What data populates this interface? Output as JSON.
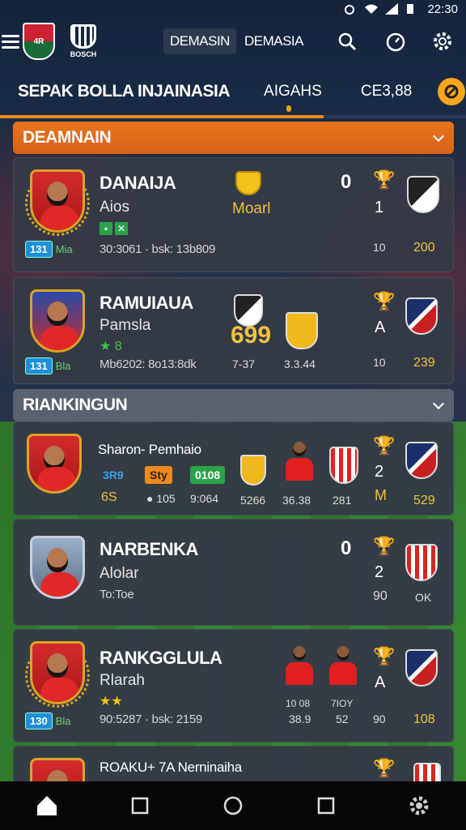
{
  "status": {
    "time": "22:30"
  },
  "header": {
    "tab_active": "DEMASIN",
    "tab_other": "DEMASIA",
    "logo2_text": "BOSCH"
  },
  "nav": {
    "title": "SEPAK BOLLA INJAINASIA",
    "item1": "AIGAHS",
    "item2": "CE3,88"
  },
  "sections": [
    {
      "label": "DEAMNAIN"
    },
    {
      "label": "RIANKINGUN"
    }
  ],
  "cards": [
    {
      "name": "DANAIJA",
      "sub": "Aios",
      "meta": "30:3061 · bsk: 13b809",
      "badge_num": "131",
      "badge_label": "Mia",
      "center_text": "Moarl",
      "score_top": "0",
      "score_mid": "1",
      "score_small": "10",
      "score_gold": "200"
    },
    {
      "name": "RAMUIAUA",
      "sub": "Pamsla",
      "meta": "Mb6202: 8o13:8dk",
      "badge_num": "131",
      "badge_label": "Bla",
      "stars": "★ 8",
      "big_num": "699",
      "left_small": "7-37",
      "mid_small": "3.3.44",
      "score_mid": "A",
      "score_small": "10",
      "score_gold": "239"
    },
    {
      "name": "Sharon- Pemhaio",
      "chip1": "3R9",
      "chip2": "Sty",
      "chip3": "0108",
      "line_gold": "6S",
      "line2a": "105",
      "line2b": "9:064",
      "c1": "5266",
      "c2": "36.38",
      "c3": "281",
      "score_mid": "2",
      "score_letter": "M",
      "score_gold": "529"
    },
    {
      "name": "NARBENKA",
      "sub": "Alolar",
      "meta": "To:Toe",
      "score_top": "0",
      "score_mid": "2",
      "score_small": "90",
      "score_right": "OK"
    },
    {
      "name": "RANKGGLULA",
      "sub": "Rlarah",
      "stars": "★★",
      "meta": "90:5287 · bsk: 2159",
      "badge_num": "130",
      "badge_label": "Bla",
      "p1_top": "10 08",
      "p1_bot": "38.9",
      "p2_top": "7IOY",
      "p2_bot": "52",
      "score_mid": "A",
      "score_small": "90",
      "score_gold": "108"
    },
    {
      "name": "ROAKU+ 7A Nerninaiha"
    }
  ],
  "colors": {
    "accent_orange": "#e8751c",
    "gold": "#f0c240",
    "card_bg": "#343a46"
  }
}
